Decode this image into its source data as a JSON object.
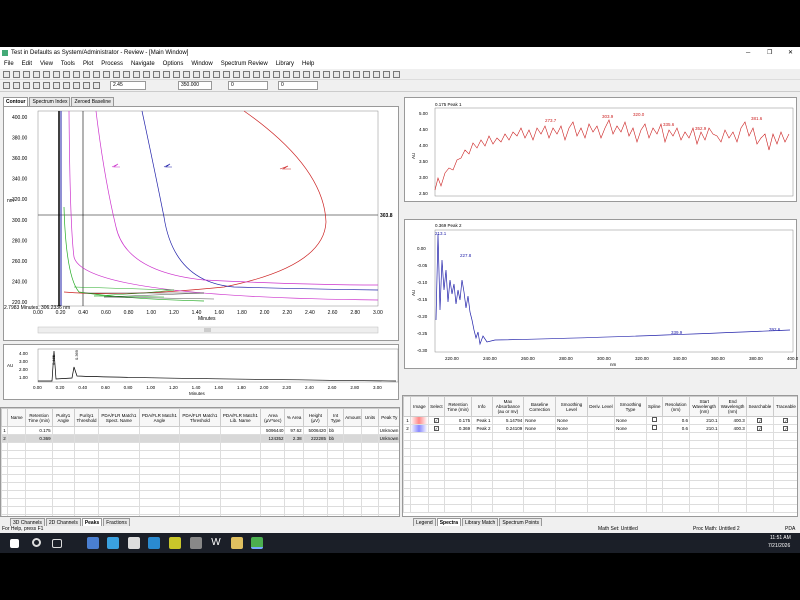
{
  "window": {
    "title": "Test in Defaults as System/Administrator - Review - [Main Window]"
  },
  "menu": [
    "File",
    "Edit",
    "View",
    "Tools",
    "Plot",
    "Process",
    "Navigate",
    "Options",
    "Window",
    "Spectrum Review",
    "Library",
    "Help"
  ],
  "toolbar2": {
    "field1": "2.45",
    "field2": "350.000",
    "field3": "0",
    "field4": "0"
  },
  "contour_tabs": [
    "Contour",
    "Spectrum Index",
    "Zeroed Baseline"
  ],
  "contour": {
    "ylabel": "nm",
    "xlabel": "Minutes",
    "cursor_label": "303.8",
    "status": "2.7983 Minutes, 306.2336 nm",
    "yticks": [
      "400.00",
      "380.00",
      "360.00",
      "340.00",
      "320.00",
      "300.00",
      "280.00",
      "260.00",
      "240.00",
      "220.00"
    ],
    "xticks": [
      "0.00",
      "0.20",
      "0.40",
      "0.60",
      "0.80",
      "1.00",
      "1.20",
      "1.40",
      "1.60",
      "1.80",
      "2.00",
      "2.20",
      "2.40",
      "2.60",
      "2.80",
      "3.00"
    ]
  },
  "chromatogram": {
    "ylabel": "AU",
    "xlabel": "Minutes",
    "yticks": [
      "4.00",
      "3.00",
      "2.00",
      "1.00"
    ],
    "xticks": [
      "0.00",
      "0.20",
      "0.40",
      "0.60",
      "0.80",
      "1.00",
      "1.20",
      "1.40",
      "1.60",
      "1.80",
      "2.00",
      "2.20",
      "2.40",
      "2.60",
      "2.80",
      "3.00"
    ],
    "peak_labels": [
      "0.175",
      "0.369"
    ]
  },
  "peaks_table": {
    "headers": [
      "Name",
      "Retention Time (min)",
      "Purity1 Angle",
      "Purity1 Threshold",
      "PDA/FLR Match1 Spect. Name",
      "PDA/FLR Match1 Angle",
      "PDA/FLR Match1 Threshold",
      "PDA/FLR Match1 Lib. Name",
      "Area (µV*sec)",
      "% Area",
      "Height (µV)",
      "Int Type",
      "Amount",
      "Units",
      "Peak Ty"
    ],
    "rows": [
      [
        "",
        "0.175",
        "",
        "",
        "",
        "",
        "",
        "",
        "5096440",
        "97.62",
        "5006420",
        "bb",
        "",
        "",
        "Unknown"
      ],
      [
        "",
        "0.369",
        "",
        "",
        "",
        "",
        "",
        "",
        "124352",
        "2.38",
        "222285",
        "bb",
        "",
        "",
        "Unknown"
      ]
    ]
  },
  "left_tabs": [
    "3D Channels",
    "2D Channels",
    "Peaks",
    "Fractions"
  ],
  "spectrum1": {
    "title": "0.175 Peak 1",
    "ylabel": "AU",
    "yticks": [
      "5.00",
      "4.50",
      "4.00",
      "3.50",
      "3.00",
      "2.50"
    ],
    "labels": [
      "273.7",
      "303.9",
      "320.0",
      "335.6",
      "352.9",
      "381.6"
    ]
  },
  "spectrum2": {
    "title": "0.369 Peak 2",
    "ylabel": "AU",
    "yticks": [
      "0.00",
      "-0.05",
      "-0.10",
      "-0.15",
      "-0.20",
      "-0.25",
      "-0.30"
    ],
    "labels": [
      "213.1",
      "227.8",
      "339.9",
      "392.6"
    ],
    "xlabel": "nm",
    "xticks": [
      "220.00",
      "240.00",
      "260.00",
      "280.00",
      "300.00",
      "320.00",
      "340.00",
      "360.00",
      "380.00",
      "400.00"
    ]
  },
  "spectra_table": {
    "headers": [
      "",
      "Image",
      "Select",
      "Retention Time (min)",
      "Info",
      "Max Absorbance (au or mv)",
      "Baseline Correction",
      "Smoothing Level",
      "Deriv. Level",
      "Smoothing Type",
      "Spline",
      "Resolution (nm)",
      "Start Wavelength (nm)",
      "End Wavelength (nm)",
      "Searchable",
      "Traceable"
    ],
    "rows": [
      [
        "1",
        "",
        "",
        "0.175",
        "Peak 1",
        "5.14794",
        "None",
        "None",
        "",
        "None",
        "",
        "0.6",
        "210.1",
        "400.3",
        "",
        ""
      ],
      [
        "2",
        "",
        "",
        "0.369",
        "Peak 2",
        "0.24109",
        "None",
        "None",
        "",
        "None",
        "",
        "0.6",
        "210.1",
        "400.3",
        "",
        ""
      ]
    ]
  },
  "right_tabs": [
    "Legend",
    "Spectra",
    "Library Match",
    "Spectrum Points"
  ],
  "status": {
    "left": "For Help, press F1",
    "mid": "Math Set: Untitled",
    "right": "Proc Math: Untitled 2",
    "far": "PDA"
  },
  "taskbar": {
    "time": "11:51 AM",
    "date": "7/21/2026"
  },
  "colors": {
    "red": "#cc2222",
    "blue": "#2222aa",
    "magenta": "#cc33cc",
    "green": "#22aa22"
  }
}
